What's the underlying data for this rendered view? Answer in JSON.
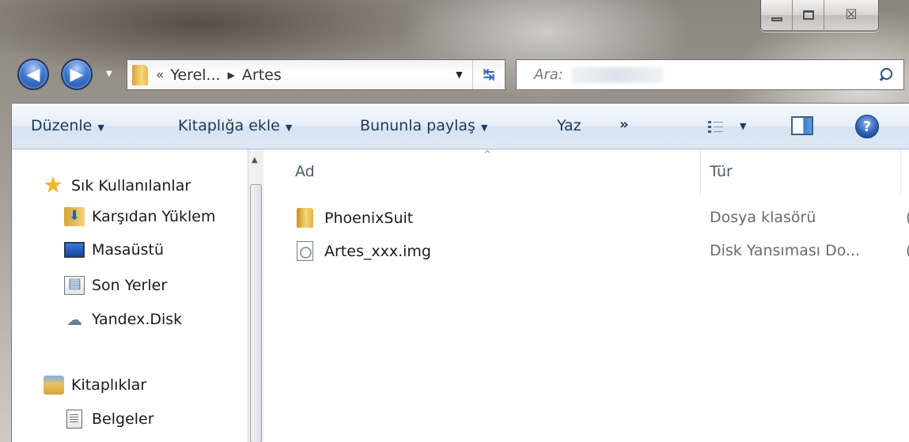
{
  "window": {
    "minimize_icon": "minimize-icon",
    "maximize_icon": "maximize-icon",
    "close_icon": "close-icon",
    "close_glyph": "☒"
  },
  "nav": {
    "back_glyph": "◀",
    "forward_glyph": "▶",
    "dropdown_glyph": "▼"
  },
  "address": {
    "prefix": "«",
    "crumb1": "Yerel...",
    "separator": "▶",
    "crumb2": "Artes",
    "dropdown_glyph": "▼",
    "refresh_glyph": "↹"
  },
  "search": {
    "placeholder": "Ara:"
  },
  "commands": {
    "organize": "Düzenle",
    "include_library": "Kitaplığa ekle",
    "share_with": "Bununla paylaş",
    "burn": "Yaz",
    "more": "»",
    "arrow": "▼",
    "help_glyph": "?"
  },
  "sidebar": {
    "favorites": "Sık Kullanılanlar",
    "items": [
      {
        "label": "Karşıdan Yüklem",
        "icon": "download-folder-icon"
      },
      {
        "label": "Masaüstü",
        "icon": "desktop-icon"
      },
      {
        "label": "Son Yerler",
        "icon": "recent-places-icon"
      },
      {
        "label": "Yandex.Disk",
        "icon": "yandex-disk-icon"
      }
    ],
    "libraries": "Kitaplıklar",
    "library_items": [
      {
        "label": "Belgeler",
        "icon": "documents-icon"
      }
    ],
    "scroll_up_glyph": "▲"
  },
  "columns": {
    "name": "Ad",
    "type": "Tür",
    "sort_glyph": "^"
  },
  "files": [
    {
      "name": "PhoenixSuit",
      "type": "Dosya klasörü",
      "clipped": "(",
      "icon": "folder-icon"
    },
    {
      "name": "Artes_xxx.img",
      "type": "Disk Yansıması Do...",
      "clipped": "(",
      "icon": "disk-image-file-icon"
    }
  ]
}
